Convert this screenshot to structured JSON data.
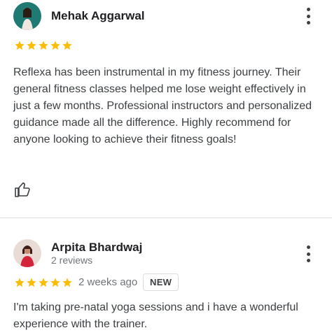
{
  "reviews": [
    {
      "name": "Mehak Aggarwal",
      "rating": 5,
      "text": "Reflexa has been instrumental in my fitness journey. Their general fitness classes helped me lose weight effectively in just a few months. Professional instructors and personalized guidance made all the difference. Highly recommend for anyone looking to achieve their fitness goals!",
      "icons": {
        "more": "more-vert-icon",
        "like": "thumbs-up-icon"
      }
    },
    {
      "name": "Arpita Bhardwaj",
      "subtitle": "2 reviews",
      "rating": 5,
      "time": "2 weeks ago",
      "badge": "NEW",
      "text": "I'm taking pre-natal yoga sessions and i have a wonderful experience with the trainer.",
      "icons": {
        "more": "more-vert-icon"
      }
    }
  ],
  "colors": {
    "star": "#fbbc04",
    "divider": "#dadce0",
    "secondary_text": "#70757a"
  }
}
